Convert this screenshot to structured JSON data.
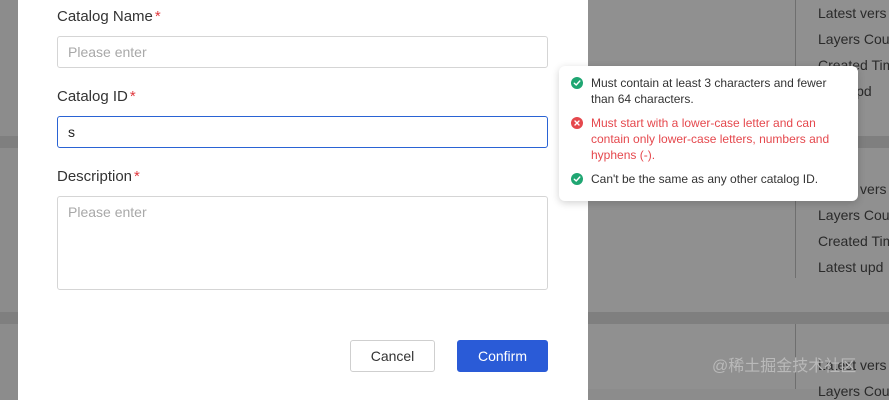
{
  "background": {
    "card1": [
      "Latest vers",
      "Layers Cou",
      "Created Tim",
      "Last upd"
    ],
    "card2": [
      "Latest vers",
      "Layers Cou",
      "Created Tim",
      "Latest upd"
    ],
    "card3": [
      "Latest vers",
      "Layers Cou"
    ]
  },
  "form": {
    "catalog_name": {
      "label": "Catalog Name",
      "required_mark": "*",
      "value": "",
      "placeholder": "Please enter"
    },
    "catalog_id": {
      "label": "Catalog ID",
      "required_mark": "*",
      "value": "s",
      "placeholder": "Please enter"
    },
    "description": {
      "label": "Description",
      "required_mark": "*",
      "value": "",
      "placeholder": "Please enter"
    }
  },
  "buttons": {
    "cancel": "Cancel",
    "confirm": "Confirm"
  },
  "validation": {
    "rules": [
      {
        "status": "ok",
        "text": "Must contain at least 3 characters and fewer than 64 characters."
      },
      {
        "status": "fail",
        "text": "Must start with a lower-case letter and can contain only lower-case letters, numbers and hyphens (-)."
      },
      {
        "status": "ok",
        "text": "Can't be the same as any other catalog ID."
      }
    ]
  },
  "watermark": "@稀土掘金技术社区",
  "colors": {
    "primary": "#2a5bd7",
    "error": "#e5484d",
    "success": "#1fa672",
    "required": "#e0383e"
  }
}
